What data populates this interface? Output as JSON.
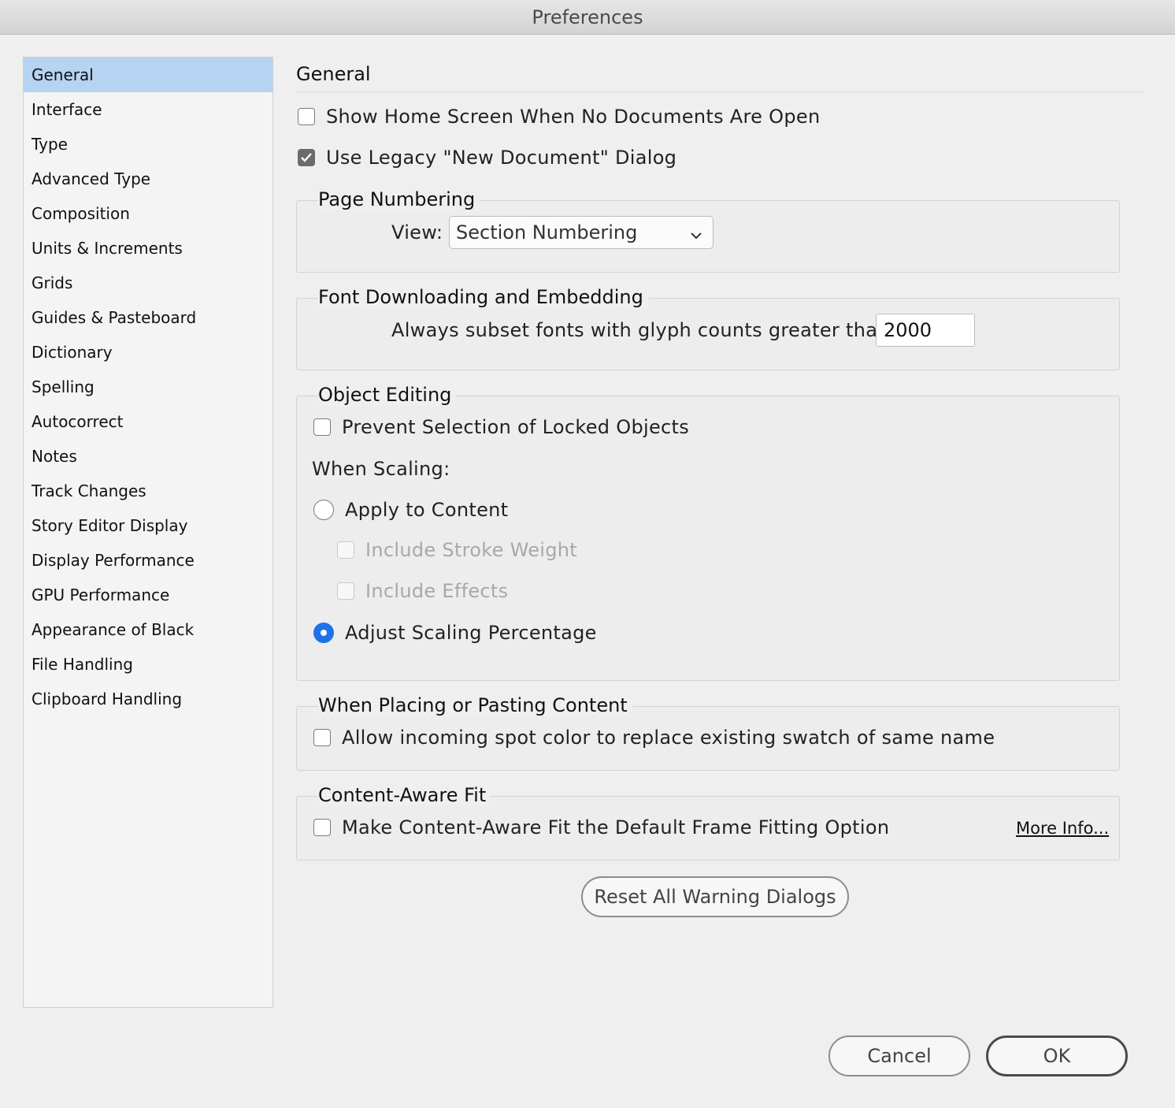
{
  "window": {
    "title": "Preferences"
  },
  "sidebar": {
    "items": [
      {
        "label": "General",
        "selected": true
      },
      {
        "label": "Interface"
      },
      {
        "label": "Type"
      },
      {
        "label": "Advanced Type"
      },
      {
        "label": "Composition"
      },
      {
        "label": "Units & Increments"
      },
      {
        "label": "Grids"
      },
      {
        "label": "Guides & Pasteboard"
      },
      {
        "label": "Dictionary"
      },
      {
        "label": "Spelling"
      },
      {
        "label": "Autocorrect"
      },
      {
        "label": "Notes"
      },
      {
        "label": "Track Changes"
      },
      {
        "label": "Story Editor Display"
      },
      {
        "label": "Display Performance"
      },
      {
        "label": "GPU Performance"
      },
      {
        "label": "Appearance of Black"
      },
      {
        "label": "File Handling"
      },
      {
        "label": "Clipboard Handling"
      }
    ]
  },
  "main": {
    "title": "General",
    "show_home_screen": {
      "label": "Show Home Screen When No Documents Are Open",
      "checked": false
    },
    "legacy_dialog": {
      "label": "Use Legacy \"New Document\" Dialog",
      "checked": true
    },
    "page_numbering": {
      "legend": "Page Numbering",
      "view_label": "View:",
      "view_value": "Section Numbering"
    },
    "font_downloading": {
      "legend": "Font Downloading and Embedding",
      "subset_label": "Always subset fonts with glyph counts greater than:",
      "subset_value": "2000"
    },
    "object_editing": {
      "legend": "Object Editing",
      "prevent_locked": {
        "label": "Prevent Selection of Locked Objects",
        "checked": false
      },
      "when_scaling": "When Scaling:",
      "apply_to_content": {
        "label": "Apply to Content",
        "selected": false
      },
      "include_stroke": {
        "label": "Include Stroke Weight",
        "checked": false,
        "disabled": true
      },
      "include_effects": {
        "label": "Include Effects",
        "checked": false,
        "disabled": true
      },
      "adjust_scaling": {
        "label": "Adjust Scaling Percentage",
        "selected": true
      }
    },
    "placing": {
      "legend": "When Placing or Pasting Content",
      "allow_spot": {
        "label": "Allow incoming spot color to replace existing swatch of same name",
        "checked": false
      }
    },
    "content_aware": {
      "legend": "Content-Aware Fit",
      "make_default": {
        "label": "Make Content-Aware Fit the Default Frame Fitting Option",
        "checked": false
      },
      "more_info": "More Info..."
    },
    "reset_button": "Reset All Warning Dialogs"
  },
  "footer": {
    "cancel": "Cancel",
    "ok": "OK"
  },
  "colors": {
    "selection": "#b6d3f2",
    "radio_accent": "#1f73e6"
  }
}
